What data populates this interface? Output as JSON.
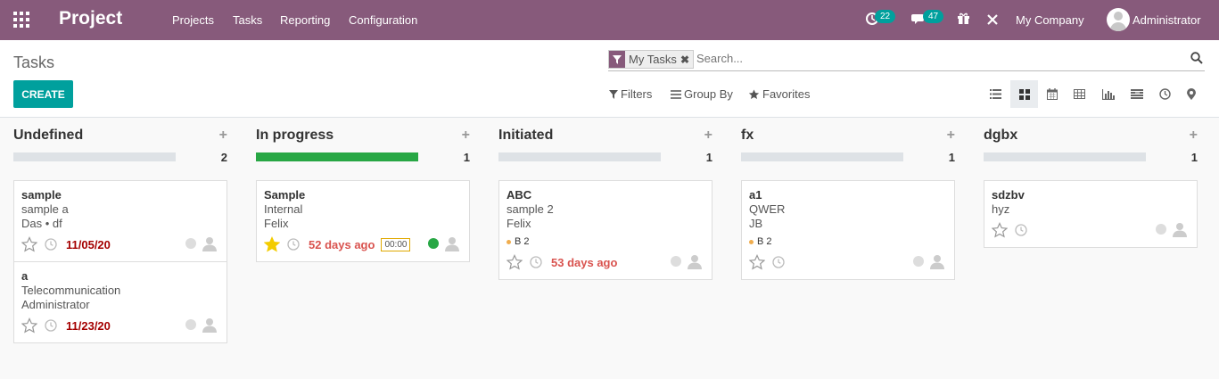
{
  "navbar": {
    "brand": "Project",
    "menu": [
      "Projects",
      "Tasks",
      "Reporting",
      "Configuration"
    ],
    "activity_count": "22",
    "message_count": "47",
    "company": "My Company",
    "user": "Administrator"
  },
  "control_panel": {
    "breadcrumb": "Tasks",
    "create_label": "CREATE",
    "search": {
      "facet_label": "My Tasks",
      "placeholder": "Search..."
    },
    "filters_label": "Filters",
    "group_by_label": "Group By",
    "favorites_label": "Favorites",
    "views": [
      "list-view-icon",
      "kanban-view-icon",
      "calendar-view-icon",
      "pivot-view-icon",
      "graph-view-icon",
      "gantt-view-icon",
      "activity-view-icon",
      "map-view-icon"
    ],
    "active_view": "kanban"
  },
  "colors": {
    "brand": "#875a7b",
    "accent": "#00a09d",
    "progress": "#28a745",
    "date": "#a50000",
    "overdue": "#d9534f",
    "star": "#f3cc00"
  },
  "columns": [
    {
      "title": "Undefined",
      "count": "2",
      "progress": 0,
      "cards": [
        {
          "title": "sample",
          "lines": [
            "sample a",
            "Das • df"
          ],
          "starred": false,
          "date": "11/05/20",
          "date_style": "date"
        },
        {
          "title": "a",
          "lines": [
            "Telecommunication",
            "Administrator"
          ],
          "starred": false,
          "date": "11/23/20",
          "date_style": "date"
        }
      ]
    },
    {
      "title": "In progress",
      "count": "1",
      "progress": 1,
      "cards": [
        {
          "title": "Sample",
          "lines": [
            "Internal",
            "Felix"
          ],
          "starred": true,
          "date": "52 days ago",
          "date_style": "overdue",
          "timer": "00:00",
          "state": "green"
        }
      ]
    },
    {
      "title": "Initiated",
      "count": "1",
      "progress": 0,
      "cards": [
        {
          "title": "ABC",
          "lines": [
            "sample 2",
            "Felix"
          ],
          "tag": "B 2",
          "starred": false,
          "date": "53 days ago",
          "date_style": "overdue"
        }
      ]
    },
    {
      "title": "fx",
      "count": "1",
      "progress": 0,
      "cards": [
        {
          "title": "a1",
          "lines": [
            "QWER",
            "JB"
          ],
          "tag": "B 2",
          "starred": false
        }
      ]
    },
    {
      "title": "dgbx",
      "count": "1",
      "progress": 0,
      "cards": [
        {
          "title": "sdzbv",
          "lines": [
            "hyz"
          ],
          "starred": false
        }
      ]
    }
  ]
}
